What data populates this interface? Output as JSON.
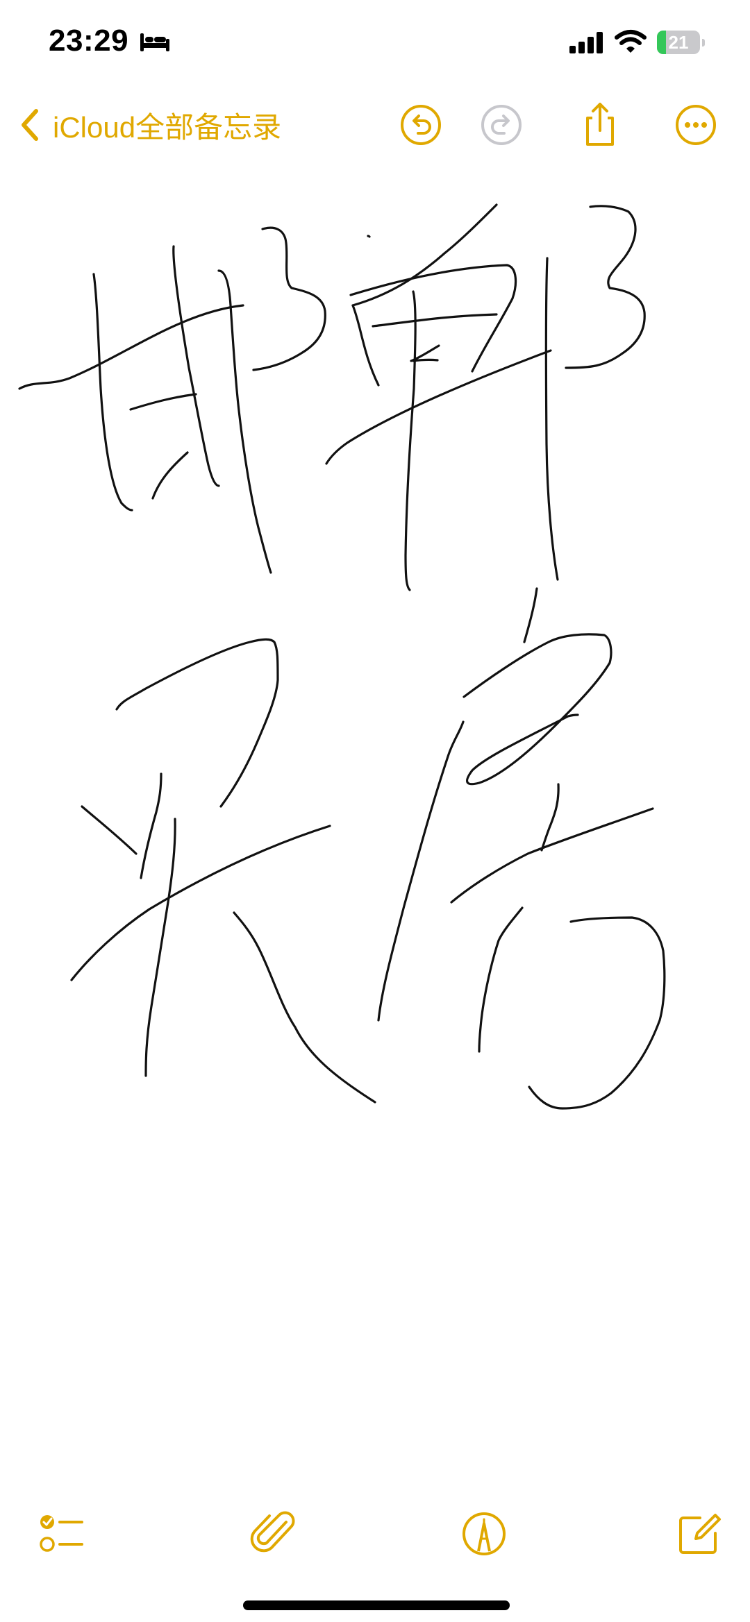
{
  "status_bar": {
    "time": "23:29",
    "battery_level": "21",
    "battery_fraction": 0.21,
    "icons": [
      "bed-icon",
      "cellular-signal-icon",
      "wifi-icon",
      "battery-charging-icon"
    ]
  },
  "nav": {
    "back_label": "iCloud全部备忘录",
    "icons": [
      "chevron-left-icon",
      "undo-icon",
      "redo-icon",
      "share-icon",
      "more-icon"
    ],
    "redo_enabled": false
  },
  "toolbar": {
    "icons": [
      "checklist-icon",
      "attachment-icon",
      "markup-pen-icon",
      "compose-icon"
    ]
  },
  "colors": {
    "accent": "#e0a800",
    "disabled": "#c7c7cc",
    "ink": "#111111",
    "battery_green": "#34c759",
    "background": "#ffffff"
  }
}
